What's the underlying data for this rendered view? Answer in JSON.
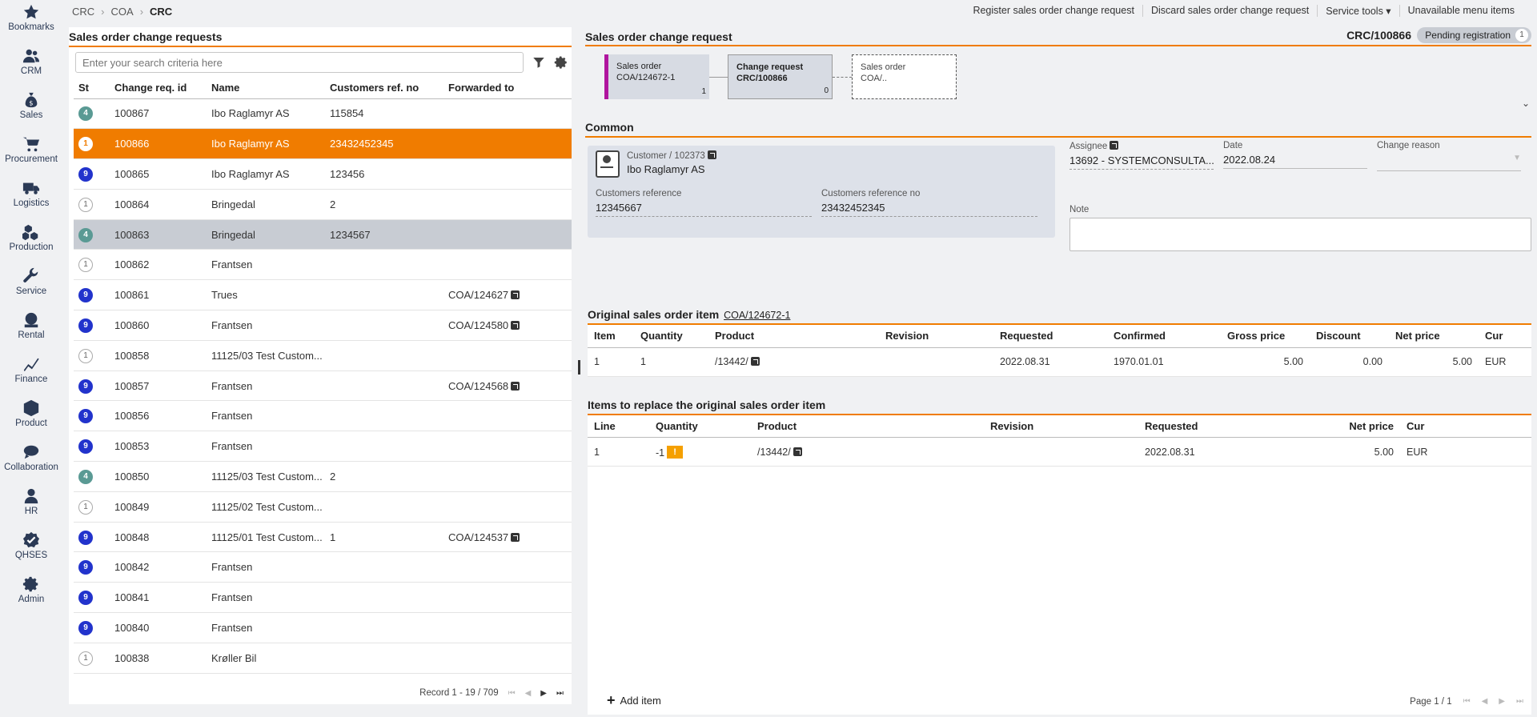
{
  "sidebar": {
    "items": [
      {
        "label": "Bookmarks",
        "icon": "star-icon"
      },
      {
        "label": "CRM",
        "icon": "people-icon"
      },
      {
        "label": "Sales",
        "icon": "money-bag-icon"
      },
      {
        "label": "Procurement",
        "icon": "cart-icon"
      },
      {
        "label": "Logistics",
        "icon": "truck-icon"
      },
      {
        "label": "Production",
        "icon": "boxes-icon"
      },
      {
        "label": "Service",
        "icon": "wrench-icon"
      },
      {
        "label": "Rental",
        "icon": "rental-icon"
      },
      {
        "label": "Finance",
        "icon": "chart-line-icon"
      },
      {
        "label": "Product",
        "icon": "cube-icon"
      },
      {
        "label": "Collaboration",
        "icon": "chat-icon"
      },
      {
        "label": "HR",
        "icon": "person-icon"
      },
      {
        "label": "QHSES",
        "icon": "badge-check-icon"
      },
      {
        "label": "Admin",
        "icon": "gear-icon"
      }
    ]
  },
  "breadcrumb": {
    "items": [
      "CRC",
      "COA"
    ],
    "current": "CRC",
    "separator": "›"
  },
  "topmenu": {
    "register": "Register sales order change request",
    "discard": "Discard sales order change request",
    "service_tools": "Service tools ▾",
    "unavailable": "Unavailable menu items"
  },
  "left": {
    "title": "Sales order change requests",
    "search_placeholder": "Enter your search criteria here",
    "columns": [
      "St",
      "Change req. id",
      "Name",
      "Customers ref. no",
      "Forwarded to"
    ],
    "rows": [
      {
        "st": "4",
        "id": "100867",
        "name": "Ibo Raglamyr AS",
        "ref": "115854",
        "fwd": ""
      },
      {
        "st": "1",
        "id": "100866",
        "name": "Ibo Raglamyr AS",
        "ref": "23432452345",
        "fwd": ""
      },
      {
        "st": "9",
        "id": "100865",
        "name": "Ibo Raglamyr AS",
        "ref": "123456",
        "fwd": ""
      },
      {
        "st": "1",
        "id": "100864",
        "name": "Bringedal",
        "ref": "2",
        "fwd": ""
      },
      {
        "st": "4",
        "id": "100863",
        "name": "Bringedal",
        "ref": "1234567",
        "fwd": ""
      },
      {
        "st": "1",
        "id": "100862",
        "name": "Frantsen",
        "ref": "",
        "fwd": ""
      },
      {
        "st": "9",
        "id": "100861",
        "name": "Trues",
        "ref": "",
        "fwd": "COA/124627"
      },
      {
        "st": "9",
        "id": "100860",
        "name": "Frantsen",
        "ref": "",
        "fwd": "COA/124580"
      },
      {
        "st": "1",
        "id": "100858",
        "name": "11125/03 Test Custom...",
        "ref": "",
        "fwd": ""
      },
      {
        "st": "9",
        "id": "100857",
        "name": "Frantsen",
        "ref": "",
        "fwd": "COA/124568"
      },
      {
        "st": "9",
        "id": "100856",
        "name": "Frantsen",
        "ref": "",
        "fwd": ""
      },
      {
        "st": "9",
        "id": "100853",
        "name": "Frantsen",
        "ref": "",
        "fwd": ""
      },
      {
        "st": "4",
        "id": "100850",
        "name": "11125/03 Test Custom...",
        "ref": "2",
        "fwd": ""
      },
      {
        "st": "1",
        "id": "100849",
        "name": "11125/02 Test Custom...",
        "ref": "",
        "fwd": ""
      },
      {
        "st": "9",
        "id": "100848",
        "name": "11125/01 Test Custom...",
        "ref": "1",
        "fwd": "COA/124537"
      },
      {
        "st": "9",
        "id": "100842",
        "name": "Frantsen",
        "ref": "",
        "fwd": ""
      },
      {
        "st": "9",
        "id": "100841",
        "name": "Frantsen",
        "ref": "",
        "fwd": ""
      },
      {
        "st": "9",
        "id": "100840",
        "name": "Frantsen",
        "ref": "",
        "fwd": ""
      },
      {
        "st": "1",
        "id": "100838",
        "name": "Krøller Bil",
        "ref": "",
        "fwd": ""
      }
    ],
    "record": "Record 1 - 19 / 709"
  },
  "right": {
    "title": "Sales order change request",
    "doc_no": "CRC/100866",
    "status": "Pending registration",
    "status_count": "1",
    "flow": [
      {
        "type": "Sales order",
        "no": "COA/124672-1",
        "count": "1"
      },
      {
        "type": "Change request",
        "no": "CRC/100866",
        "count": "0"
      },
      {
        "type": "Sales order",
        "no": "COA/.."
      }
    ],
    "common": {
      "title": "Common",
      "customer_label": "Customer / 102373",
      "customer_name": "Ibo Raglamyr AS",
      "cust_ref_label": "Customers reference",
      "cust_ref": "12345667",
      "cust_ref_no_label": "Customers reference no",
      "cust_ref_no": "23432452345",
      "assignee_label": "Assignee",
      "assignee": "13692 - SYSTEMCONSULTA...",
      "date_label": "Date",
      "date": "2022.08.24",
      "reason_label": "Change reason",
      "note_label": "Note"
    },
    "original": {
      "title": "Original sales order item",
      "link": "COA/124672-1",
      "columns": [
        "Item",
        "Quantity",
        "Product",
        "Revision",
        "Requested",
        "Confirmed",
        "Gross price",
        "Discount",
        "Net price",
        "Cur"
      ],
      "row": {
        "item": "1",
        "qty": "1",
        "product": "/13442/",
        "revision": "",
        "requested": "2022.08.31",
        "confirmed": "1970.01.01",
        "gross": "5.00",
        "discount": "0.00",
        "net": "5.00",
        "cur": "EUR"
      }
    },
    "replace": {
      "title": "Items to replace the original sales order item",
      "columns": [
        "Line",
        "Quantity",
        "Product",
        "Revision",
        "Requested",
        "Net price",
        "Cur"
      ],
      "row": {
        "line": "1",
        "qty": "-1",
        "product": "/13442/",
        "revision": "",
        "requested": "2022.08.31",
        "net": "5.00",
        "cur": "EUR"
      }
    },
    "add_item": "Add item",
    "page": "Page 1 / 1"
  }
}
